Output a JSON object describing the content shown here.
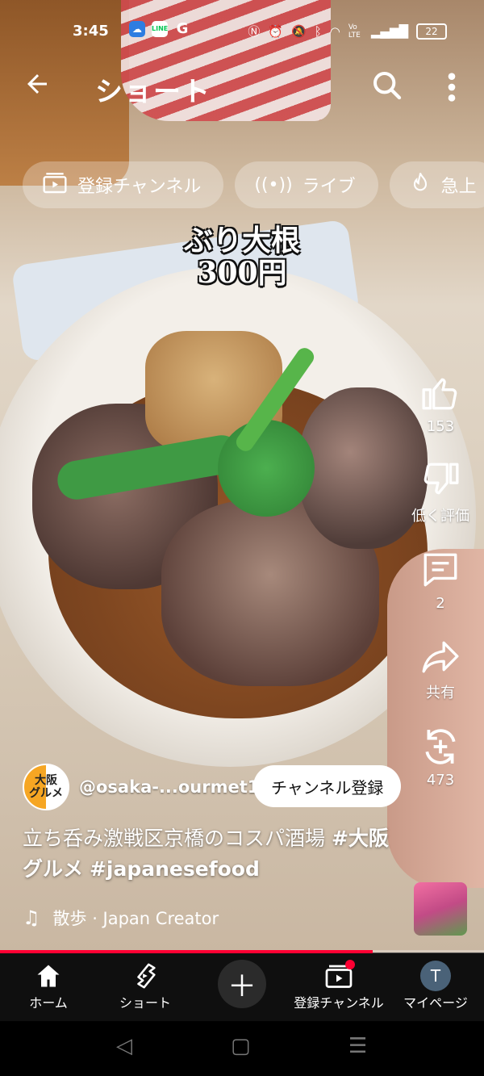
{
  "status_bar": {
    "time": "3:45",
    "app_icons": [
      "weather-icon",
      "line-icon",
      "google-icon"
    ],
    "line_label": "LINE",
    "google_label": "G",
    "volte_label": "Vo LTE",
    "battery": "22"
  },
  "top_bar": {
    "back_icon": "arrow-left-icon",
    "title": "ショート",
    "search_icon": "search-icon",
    "more_icon": "more-vertical-icon"
  },
  "chips": [
    {
      "label": "登録チャンネル",
      "icon": "subscriptions-icon"
    },
    {
      "label": "ライブ",
      "icon": "live-icon"
    },
    {
      "label": "急上",
      "icon": "trending-icon"
    }
  ],
  "video": {
    "caption_line1": "ぶり大根",
    "caption_line2": "300円"
  },
  "actions": {
    "like_count": "153",
    "dislike_label": "低く評価",
    "comment_count": "2",
    "share_label": "共有",
    "remix_count": "473"
  },
  "channel": {
    "avatar_line1": "大阪",
    "avatar_line2": "グルメ",
    "handle": "@osaka-...ourmet1",
    "subscribe_label": "チャンネル登録"
  },
  "description": {
    "text": "立ち呑み激戦区京橋のコスパ酒場 ",
    "tag1": "#大阪グルメ",
    "tag2": "#japanesefood"
  },
  "music": {
    "text": "散歩 · Japan Creator"
  },
  "progress": {
    "fraction": 0.77,
    "color": "#ff0033"
  },
  "bottom_nav": {
    "home": "ホーム",
    "shorts": "ショート",
    "create_icon": "plus-icon",
    "subscriptions": "登録チャンネル",
    "mypage": "マイページ",
    "avatar_letter": "T"
  }
}
